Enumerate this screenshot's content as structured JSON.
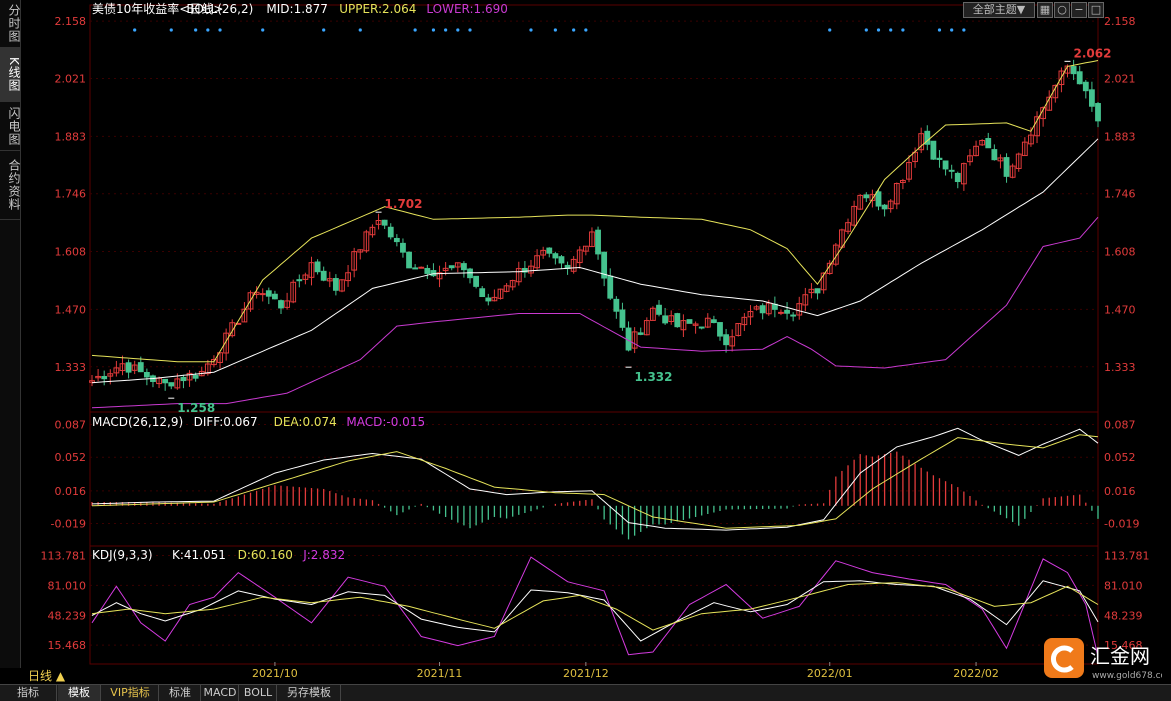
{
  "sidebar": {
    "tabs": [
      {
        "label": "分时图",
        "active": false
      },
      {
        "label": "K线图",
        "active": true
      },
      {
        "label": "闪电图",
        "active": false
      },
      {
        "label": "合约资料",
        "active": false
      }
    ]
  },
  "toolbar": {
    "theme_select": "全部主题▼",
    "icons": [
      "grid-icon",
      "circle-icon",
      "minimize-icon",
      "maximize-icon"
    ]
  },
  "legend": {
    "main": {
      "name": "美债10年收益率",
      "period": "<日线>",
      "indicator": "BOLL(26,2)",
      "mid": "MID:1.877",
      "upper": "UPPER:2.064",
      "lower": "LOWER:1.690"
    },
    "macd": {
      "name": "MACD(26,12,9)",
      "diff": "DIFF:0.067",
      "dea": "DEA:0.074",
      "macd": "MACD:-0.015"
    },
    "kdj": {
      "name": "KDJ(9,3,3)",
      "k": "K:41.051",
      "d": "D:60.160",
      "j": "J:2.832"
    }
  },
  "colors": {
    "up": "#e23b3b",
    "down": "#45c28e",
    "mid_line": "#ffffff",
    "upper_line": "#e6e35a",
    "lower_line": "#c93ad1",
    "diff_line": "#ffffff",
    "dea_line": "#e6e35a",
    "k_line": "#ffffff",
    "d_line": "#e6e35a",
    "j_line": "#d43be0",
    "axis_text": "#e23b3b",
    "grid": "#3a0000"
  },
  "chart_data": {
    "type": "candlestick",
    "panels": [
      {
        "name": "price",
        "ylim": [
          1.225,
          2.175
        ],
        "ticks": [
          "2.158",
          "2.021",
          "1.883",
          "1.746",
          "1.608",
          "1.470",
          "1.333"
        ],
        "tick_values": [
          2.158,
          2.021,
          1.883,
          1.746,
          1.608,
          1.47,
          1.333
        ],
        "annotations": [
          {
            "text": "1.258",
            "index": 13,
            "value": 1.258
          },
          {
            "text": "1.702",
            "index": 47,
            "value": 1.702
          },
          {
            "text": "1.332",
            "index": 88,
            "value": 1.332
          },
          {
            "text": "2.062",
            "index": 160,
            "value": 2.062
          }
        ]
      },
      {
        "name": "macd",
        "ylim": [
          -0.042,
          0.094
        ],
        "ticks": [
          "0.087",
          "0.052",
          "0.016",
          "-0.019"
        ],
        "tick_values": [
          0.087,
          0.052,
          0.016,
          -0.019
        ]
      },
      {
        "name": "kdj",
        "ylim": [
          -3,
          122
        ],
        "ticks": [
          "113.781",
          "81.010",
          "48.239",
          "15.468"
        ],
        "tick_values": [
          113.781,
          81.01,
          48.239,
          15.468
        ]
      }
    ],
    "x_labels": [
      {
        "label": "2021/10",
        "index": 30
      },
      {
        "label": "2021/11",
        "index": 57
      },
      {
        "label": "2021/12",
        "index": 81
      },
      {
        "label": "2022/01",
        "index": 121
      },
      {
        "label": "2022/02",
        "index": 145
      }
    ],
    "anchors": [
      {
        "i": 0,
        "c": 1.3
      },
      {
        "i": 5,
        "c": 1.34
      },
      {
        "i": 12,
        "c": 1.29
      },
      {
        "i": 13,
        "c": 1.3
      },
      {
        "i": 18,
        "c": 1.32
      },
      {
        "i": 22,
        "c": 1.4
      },
      {
        "i": 27,
        "c": 1.52
      },
      {
        "i": 31,
        "c": 1.48
      },
      {
        "i": 36,
        "c": 1.58
      },
      {
        "i": 40,
        "c": 1.52
      },
      {
        "i": 44,
        "c": 1.62
      },
      {
        "i": 47,
        "c": 1.69
      },
      {
        "i": 52,
        "c": 1.58
      },
      {
        "i": 57,
        "c": 1.56
      },
      {
        "i": 61,
        "c": 1.57
      },
      {
        "i": 65,
        "c": 1.48
      },
      {
        "i": 67,
        "c": 1.52
      },
      {
        "i": 70,
        "c": 1.56
      },
      {
        "i": 74,
        "c": 1.6
      },
      {
        "i": 78,
        "c": 1.56
      },
      {
        "i": 82,
        "c": 1.66
      },
      {
        "i": 85,
        "c": 1.5
      },
      {
        "i": 88,
        "c": 1.38
      },
      {
        "i": 92,
        "c": 1.47
      },
      {
        "i": 96,
        "c": 1.43
      },
      {
        "i": 101,
        "c": 1.44
      },
      {
        "i": 104,
        "c": 1.4
      },
      {
        "i": 108,
        "c": 1.46
      },
      {
        "i": 112,
        "c": 1.48
      },
      {
        "i": 115,
        "c": 1.47
      },
      {
        "i": 119,
        "c": 1.52
      },
      {
        "i": 122,
        "c": 1.63
      },
      {
        "i": 126,
        "c": 1.75
      },
      {
        "i": 130,
        "c": 1.72
      },
      {
        "i": 133,
        "c": 1.79
      },
      {
        "i": 136,
        "c": 1.89
      },
      {
        "i": 139,
        "c": 1.82
      },
      {
        "i": 142,
        "c": 1.78
      },
      {
        "i": 146,
        "c": 1.88
      },
      {
        "i": 150,
        "c": 1.8
      },
      {
        "i": 154,
        "c": 1.9
      },
      {
        "i": 157,
        "c": 1.98
      },
      {
        "i": 160,
        "c": 2.05
      },
      {
        "i": 162,
        "c": 2.02
      },
      {
        "i": 163,
        "c": 1.98
      },
      {
        "i": 164,
        "c": 1.95
      },
      {
        "i": 165,
        "c": 1.92
      }
    ],
    "upper_band": [
      {
        "i": 0,
        "v": 1.36
      },
      {
        "i": 14,
        "v": 1.345
      },
      {
        "i": 20,
        "v": 1.345
      },
      {
        "i": 28,
        "v": 1.54
      },
      {
        "i": 36,
        "v": 1.64
      },
      {
        "i": 44,
        "v": 1.69
      },
      {
        "i": 48,
        "v": 1.715
      },
      {
        "i": 56,
        "v": 1.685
      },
      {
        "i": 70,
        "v": 1.69
      },
      {
        "i": 78,
        "v": 1.695
      },
      {
        "i": 82,
        "v": 1.695
      },
      {
        "i": 90,
        "v": 1.69
      },
      {
        "i": 100,
        "v": 1.685
      },
      {
        "i": 108,
        "v": 1.66
      },
      {
        "i": 114,
        "v": 1.615
      },
      {
        "i": 119,
        "v": 1.53
      },
      {
        "i": 124,
        "v": 1.64
      },
      {
        "i": 130,
        "v": 1.78
      },
      {
        "i": 136,
        "v": 1.86
      },
      {
        "i": 140,
        "v": 1.91
      },
      {
        "i": 150,
        "v": 1.915
      },
      {
        "i": 154,
        "v": 1.895
      },
      {
        "i": 160,
        "v": 2.05
      },
      {
        "i": 165,
        "v": 2.064
      }
    ],
    "mid_band": [
      {
        "i": 0,
        "v": 1.295
      },
      {
        "i": 10,
        "v": 1.305
      },
      {
        "i": 20,
        "v": 1.32
      },
      {
        "i": 28,
        "v": 1.37
      },
      {
        "i": 36,
        "v": 1.42
      },
      {
        "i": 46,
        "v": 1.52
      },
      {
        "i": 56,
        "v": 1.555
      },
      {
        "i": 70,
        "v": 1.56
      },
      {
        "i": 80,
        "v": 1.57
      },
      {
        "i": 90,
        "v": 1.53
      },
      {
        "i": 100,
        "v": 1.505
      },
      {
        "i": 110,
        "v": 1.49
      },
      {
        "i": 119,
        "v": 1.455
      },
      {
        "i": 126,
        "v": 1.49
      },
      {
        "i": 136,
        "v": 1.58
      },
      {
        "i": 146,
        "v": 1.66
      },
      {
        "i": 156,
        "v": 1.75
      },
      {
        "i": 165,
        "v": 1.877
      }
    ],
    "lower_band": [
      {
        "i": 0,
        "v": 1.235
      },
      {
        "i": 14,
        "v": 1.245
      },
      {
        "i": 22,
        "v": 1.245
      },
      {
        "i": 32,
        "v": 1.27
      },
      {
        "i": 44,
        "v": 1.35
      },
      {
        "i": 50,
        "v": 1.43
      },
      {
        "i": 56,
        "v": 1.44
      },
      {
        "i": 70,
        "v": 1.46
      },
      {
        "i": 80,
        "v": 1.46
      },
      {
        "i": 90,
        "v": 1.38
      },
      {
        "i": 100,
        "v": 1.37
      },
      {
        "i": 110,
        "v": 1.375
      },
      {
        "i": 114,
        "v": 1.405
      },
      {
        "i": 118,
        "v": 1.375
      },
      {
        "i": 122,
        "v": 1.335
      },
      {
        "i": 130,
        "v": 1.33
      },
      {
        "i": 140,
        "v": 1.35
      },
      {
        "i": 150,
        "v": 1.48
      },
      {
        "i": 156,
        "v": 1.62
      },
      {
        "i": 162,
        "v": 1.64
      },
      {
        "i": 165,
        "v": 1.69
      }
    ],
    "diff_line": [
      {
        "i": 0,
        "v": 0.002
      },
      {
        "i": 10,
        "v": 0.004
      },
      {
        "i": 20,
        "v": 0.005
      },
      {
        "i": 30,
        "v": 0.035
      },
      {
        "i": 38,
        "v": 0.049
      },
      {
        "i": 46,
        "v": 0.056
      },
      {
        "i": 54,
        "v": 0.05
      },
      {
        "i": 62,
        "v": 0.018
      },
      {
        "i": 68,
        "v": 0.012
      },
      {
        "i": 76,
        "v": 0.015
      },
      {
        "i": 82,
        "v": 0.016
      },
      {
        "i": 88,
        "v": -0.018
      },
      {
        "i": 94,
        "v": -0.024
      },
      {
        "i": 104,
        "v": -0.026
      },
      {
        "i": 114,
        "v": -0.023
      },
      {
        "i": 120,
        "v": -0.015
      },
      {
        "i": 126,
        "v": 0.035
      },
      {
        "i": 132,
        "v": 0.063
      },
      {
        "i": 138,
        "v": 0.074
      },
      {
        "i": 142,
        "v": 0.083
      },
      {
        "i": 146,
        "v": 0.07
      },
      {
        "i": 152,
        "v": 0.054
      },
      {
        "i": 156,
        "v": 0.066
      },
      {
        "i": 162,
        "v": 0.082
      },
      {
        "i": 165,
        "v": 0.067
      }
    ],
    "dea_line": [
      {
        "i": 0,
        "v": 0.0
      },
      {
        "i": 20,
        "v": 0.004
      },
      {
        "i": 32,
        "v": 0.028
      },
      {
        "i": 42,
        "v": 0.048
      },
      {
        "i": 50,
        "v": 0.058
      },
      {
        "i": 58,
        "v": 0.04
      },
      {
        "i": 66,
        "v": 0.02
      },
      {
        "i": 76,
        "v": 0.014
      },
      {
        "i": 84,
        "v": 0.012
      },
      {
        "i": 92,
        "v": -0.012
      },
      {
        "i": 104,
        "v": -0.024
      },
      {
        "i": 116,
        "v": -0.021
      },
      {
        "i": 122,
        "v": -0.014
      },
      {
        "i": 128,
        "v": 0.018
      },
      {
        "i": 136,
        "v": 0.05
      },
      {
        "i": 142,
        "v": 0.073
      },
      {
        "i": 150,
        "v": 0.066
      },
      {
        "i": 156,
        "v": 0.062
      },
      {
        "i": 162,
        "v": 0.076
      },
      {
        "i": 165,
        "v": 0.074
      }
    ],
    "kdj_k": [
      {
        "i": 0,
        "v": 48
      },
      {
        "i": 4,
        "v": 62
      },
      {
        "i": 8,
        "v": 50
      },
      {
        "i": 12,
        "v": 42
      },
      {
        "i": 18,
        "v": 55
      },
      {
        "i": 24,
        "v": 75
      },
      {
        "i": 30,
        "v": 66
      },
      {
        "i": 36,
        "v": 60
      },
      {
        "i": 42,
        "v": 74
      },
      {
        "i": 48,
        "v": 70
      },
      {
        "i": 54,
        "v": 44
      },
      {
        "i": 60,
        "v": 35
      },
      {
        "i": 66,
        "v": 30
      },
      {
        "i": 72,
        "v": 76
      },
      {
        "i": 78,
        "v": 73
      },
      {
        "i": 84,
        "v": 65
      },
      {
        "i": 90,
        "v": 20
      },
      {
        "i": 96,
        "v": 42
      },
      {
        "i": 102,
        "v": 62
      },
      {
        "i": 108,
        "v": 52
      },
      {
        "i": 114,
        "v": 60
      },
      {
        "i": 120,
        "v": 85
      },
      {
        "i": 126,
        "v": 86
      },
      {
        "i": 132,
        "v": 82
      },
      {
        "i": 138,
        "v": 80
      },
      {
        "i": 144,
        "v": 66
      },
      {
        "i": 150,
        "v": 38
      },
      {
        "i": 156,
        "v": 86
      },
      {
        "i": 162,
        "v": 75
      },
      {
        "i": 165,
        "v": 41
      }
    ],
    "kdj_d": [
      {
        "i": 0,
        "v": 50
      },
      {
        "i": 6,
        "v": 55
      },
      {
        "i": 12,
        "v": 50
      },
      {
        "i": 20,
        "v": 55
      },
      {
        "i": 28,
        "v": 68
      },
      {
        "i": 36,
        "v": 62
      },
      {
        "i": 44,
        "v": 68
      },
      {
        "i": 52,
        "v": 58
      },
      {
        "i": 60,
        "v": 44
      },
      {
        "i": 66,
        "v": 34
      },
      {
        "i": 74,
        "v": 64
      },
      {
        "i": 80,
        "v": 70
      },
      {
        "i": 86,
        "v": 55
      },
      {
        "i": 92,
        "v": 32
      },
      {
        "i": 100,
        "v": 50
      },
      {
        "i": 108,
        "v": 55
      },
      {
        "i": 116,
        "v": 68
      },
      {
        "i": 124,
        "v": 82
      },
      {
        "i": 132,
        "v": 84
      },
      {
        "i": 140,
        "v": 78
      },
      {
        "i": 148,
        "v": 58
      },
      {
        "i": 154,
        "v": 62
      },
      {
        "i": 160,
        "v": 80
      },
      {
        "i": 165,
        "v": 60
      }
    ],
    "kdj_j": [
      {
        "i": 0,
        "v": 40
      },
      {
        "i": 4,
        "v": 80
      },
      {
        "i": 8,
        "v": 40
      },
      {
        "i": 12,
        "v": 20
      },
      {
        "i": 16,
        "v": 60
      },
      {
        "i": 20,
        "v": 68
      },
      {
        "i": 24,
        "v": 95
      },
      {
        "i": 30,
        "v": 68
      },
      {
        "i": 36,
        "v": 40
      },
      {
        "i": 42,
        "v": 90
      },
      {
        "i": 48,
        "v": 80
      },
      {
        "i": 54,
        "v": 25
      },
      {
        "i": 60,
        "v": 15
      },
      {
        "i": 66,
        "v": 25
      },
      {
        "i": 72,
        "v": 112
      },
      {
        "i": 78,
        "v": 85
      },
      {
        "i": 84,
        "v": 75
      },
      {
        "i": 88,
        "v": 5
      },
      {
        "i": 92,
        "v": 8
      },
      {
        "i": 98,
        "v": 60
      },
      {
        "i": 104,
        "v": 82
      },
      {
        "i": 110,
        "v": 45
      },
      {
        "i": 116,
        "v": 58
      },
      {
        "i": 122,
        "v": 108
      },
      {
        "i": 128,
        "v": 95
      },
      {
        "i": 134,
        "v": 88
      },
      {
        "i": 140,
        "v": 82
      },
      {
        "i": 146,
        "v": 55
      },
      {
        "i": 150,
        "v": 12
      },
      {
        "i": 156,
        "v": 110
      },
      {
        "i": 160,
        "v": 95
      },
      {
        "i": 163,
        "v": 60
      },
      {
        "i": 165,
        "v": 3
      }
    ],
    "signal_dots": [
      7,
      13,
      17,
      19,
      21,
      28,
      38,
      44,
      53,
      56,
      58,
      60,
      62,
      72,
      76,
      79,
      81,
      121,
      127,
      129,
      131,
      133,
      139,
      141,
      143
    ]
  }
}
